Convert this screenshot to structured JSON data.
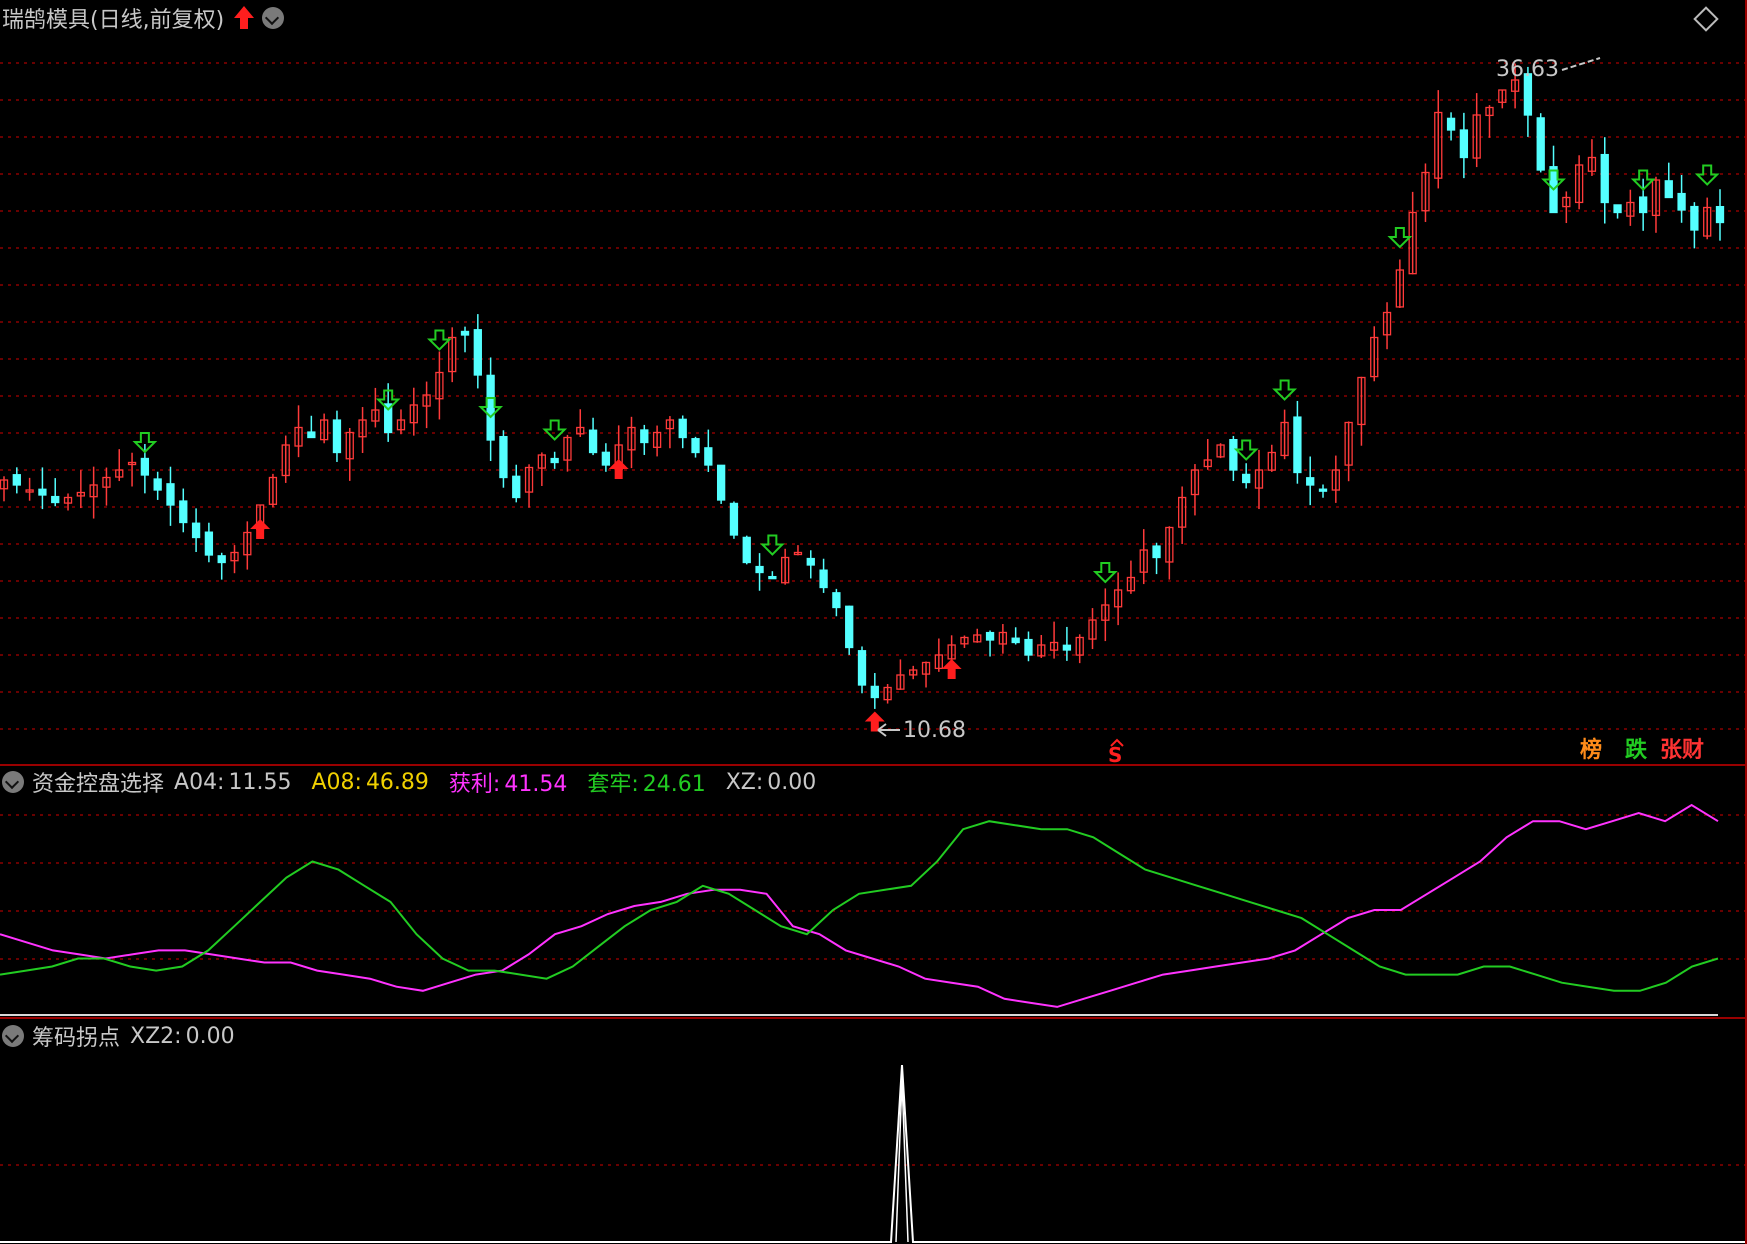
{
  "header": {
    "title": "瑞鹄模具(日线,前复权)",
    "high_label": "36.63",
    "low_label": "10.68",
    "s_marker": "S"
  },
  "badges": [
    {
      "label": "榜",
      "color": "#ff8c1a"
    },
    {
      "label": "跌",
      "color": "#22cc22"
    },
    {
      "label": "张财",
      "color": "#ff3333"
    }
  ],
  "indicator1": {
    "name": "资金控盘选择",
    "values": [
      {
        "label": "A04:",
        "value": "11.55",
        "color": "#d8d8d8"
      },
      {
        "label": "A08:",
        "value": "46.89",
        "color": "#f0d000"
      },
      {
        "label": "获利:",
        "value": "41.54",
        "color": "#ff33ff"
      },
      {
        "label": "套牢:",
        "value": "24.61",
        "color": "#22cc22"
      },
      {
        "label": "XZ:",
        "value": "0.00",
        "color": "#d8d8d8"
      }
    ]
  },
  "indicator2": {
    "name": "筹码拐点",
    "values": [
      {
        "label": "XZ2:",
        "value": "0.00",
        "color": "#d8d8d8"
      }
    ]
  },
  "colors": {
    "up": "#ff3a3a",
    "down": "#54ffff",
    "grid": "#8a0000",
    "profit": "#ff33ff",
    "trapped": "#22cc22",
    "signal": "#ffffff"
  },
  "chart_data": [
    {
      "type": "candlestick",
      "title": "瑞鹄模具(日线,前复权)",
      "annotations": [
        "36.63",
        "10.68"
      ],
      "closes": [
        20.2,
        20.0,
        19.8,
        19.6,
        19.3,
        19.5,
        19.7,
        20.0,
        20.3,
        20.6,
        20.9,
        20.4,
        19.8,
        19.2,
        18.5,
        17.9,
        17.2,
        16.9,
        17.3,
        18.1,
        19.2,
        20.3,
        21.6,
        22.3,
        21.9,
        22.6,
        21.3,
        22.1,
        22.6,
        23.0,
        22.1,
        22.6,
        23.2,
        23.6,
        24.5,
        25.9,
        26.0,
        24.4,
        21.8,
        20.3,
        19.5,
        20.7,
        21.2,
        20.9,
        21.9,
        22.3,
        21.3,
        20.8,
        21.6,
        22.3,
        21.7,
        22.1,
        22.6,
        21.9,
        21.3,
        20.8,
        19.4,
        18.0,
        16.9,
        16.5,
        16.3,
        17.1,
        17.3,
        16.8,
        15.9,
        15.1,
        13.5,
        12.0,
        11.5,
        11.9,
        12.4,
        12.6,
        12.9,
        13.2,
        13.6,
        13.9,
        14.0,
        13.8,
        14.1,
        13.7,
        13.2,
        13.6,
        13.7,
        13.4,
        13.9,
        14.6,
        15.2,
        15.8,
        16.3,
        17.4,
        17.1,
        18.3,
        19.5,
        20.6,
        21.0,
        21.6,
        20.6,
        20.1,
        20.6,
        21.3,
        22.5,
        20.5,
        20.0,
        19.8,
        20.6,
        22.5,
        24.3,
        25.9,
        26.9,
        28.6,
        30.9,
        32.5,
        34.9,
        34.2,
        33.1,
        34.8,
        35.1,
        35.8,
        36.2,
        34.8,
        32.6,
        30.9,
        31.5,
        32.8,
        33.1,
        31.3,
        30.9,
        31.3,
        30.9,
        32.2,
        31.5,
        31.0,
        30.2,
        31.1,
        30.5
      ]
    },
    {
      "type": "line",
      "title": "资金控盘选择",
      "series": [
        {
          "name": "获利",
          "values": [
            30,
            29,
            28,
            27.5,
            27,
            27.5,
            28,
            28,
            27.5,
            27,
            26.5,
            26.5,
            25.5,
            25,
            24.5,
            23.5,
            23,
            24,
            25,
            25.5,
            27.5,
            30,
            31,
            32.5,
            33.5,
            34,
            35,
            35.5,
            35.5,
            35,
            31,
            30,
            28,
            27,
            26,
            24.5,
            24,
            23.5,
            22,
            21.5,
            21,
            22,
            23,
            24,
            25,
            25.5,
            26,
            26.5,
            27,
            28,
            30,
            32,
            33,
            33,
            35,
            37,
            39,
            42,
            44,
            44,
            43,
            44,
            45,
            44,
            46,
            44
          ]
        },
        {
          "name": "套牢",
          "values": [
            25,
            25.5,
            26,
            27,
            27,
            26,
            25.5,
            26,
            28,
            31,
            34,
            37,
            39,
            38,
            36,
            34,
            30,
            27,
            25.5,
            25.5,
            25,
            24.5,
            26,
            28.5,
            31,
            33,
            34,
            36,
            35,
            33,
            31,
            30,
            33,
            35,
            35.5,
            36,
            39,
            43,
            44,
            43.5,
            43,
            43,
            42,
            40,
            38,
            37,
            36,
            35,
            34,
            33,
            32,
            30,
            28,
            26,
            25,
            25,
            25,
            26,
            26,
            25,
            24,
            23.5,
            23,
            23,
            24,
            26,
            27
          ]
        }
      ]
    },
    {
      "type": "line",
      "title": "筹码拐点",
      "series": [
        {
          "name": "XZ2",
          "values": [
            0,
            0,
            1,
            0,
            0
          ]
        }
      ]
    }
  ]
}
